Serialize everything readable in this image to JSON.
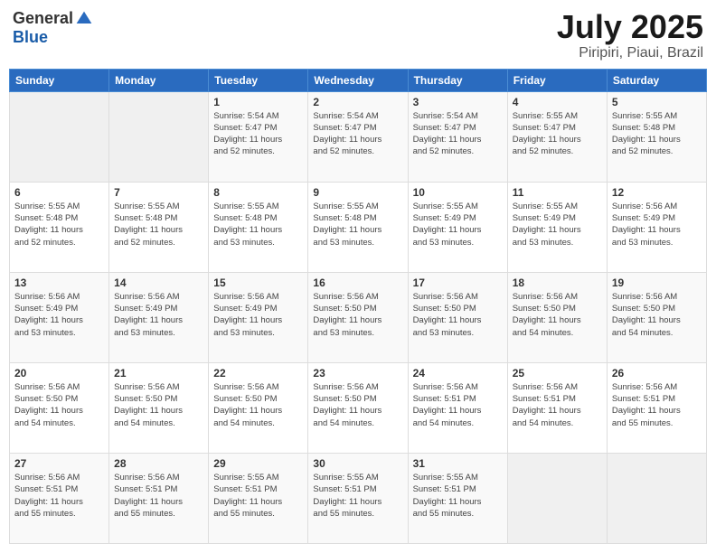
{
  "header": {
    "logo_general": "General",
    "logo_blue": "Blue",
    "month_title": "July 2025",
    "location": "Piripiri, Piaui, Brazil"
  },
  "calendar": {
    "headers": [
      "Sunday",
      "Monday",
      "Tuesday",
      "Wednesday",
      "Thursday",
      "Friday",
      "Saturday"
    ],
    "weeks": [
      [
        {
          "day": "",
          "info": ""
        },
        {
          "day": "",
          "info": ""
        },
        {
          "day": "1",
          "info": "Sunrise: 5:54 AM\nSunset: 5:47 PM\nDaylight: 11 hours\nand 52 minutes."
        },
        {
          "day": "2",
          "info": "Sunrise: 5:54 AM\nSunset: 5:47 PM\nDaylight: 11 hours\nand 52 minutes."
        },
        {
          "day": "3",
          "info": "Sunrise: 5:54 AM\nSunset: 5:47 PM\nDaylight: 11 hours\nand 52 minutes."
        },
        {
          "day": "4",
          "info": "Sunrise: 5:55 AM\nSunset: 5:47 PM\nDaylight: 11 hours\nand 52 minutes."
        },
        {
          "day": "5",
          "info": "Sunrise: 5:55 AM\nSunset: 5:48 PM\nDaylight: 11 hours\nand 52 minutes."
        }
      ],
      [
        {
          "day": "6",
          "info": "Sunrise: 5:55 AM\nSunset: 5:48 PM\nDaylight: 11 hours\nand 52 minutes."
        },
        {
          "day": "7",
          "info": "Sunrise: 5:55 AM\nSunset: 5:48 PM\nDaylight: 11 hours\nand 52 minutes."
        },
        {
          "day": "8",
          "info": "Sunrise: 5:55 AM\nSunset: 5:48 PM\nDaylight: 11 hours\nand 53 minutes."
        },
        {
          "day": "9",
          "info": "Sunrise: 5:55 AM\nSunset: 5:48 PM\nDaylight: 11 hours\nand 53 minutes."
        },
        {
          "day": "10",
          "info": "Sunrise: 5:55 AM\nSunset: 5:49 PM\nDaylight: 11 hours\nand 53 minutes."
        },
        {
          "day": "11",
          "info": "Sunrise: 5:55 AM\nSunset: 5:49 PM\nDaylight: 11 hours\nand 53 minutes."
        },
        {
          "day": "12",
          "info": "Sunrise: 5:56 AM\nSunset: 5:49 PM\nDaylight: 11 hours\nand 53 minutes."
        }
      ],
      [
        {
          "day": "13",
          "info": "Sunrise: 5:56 AM\nSunset: 5:49 PM\nDaylight: 11 hours\nand 53 minutes."
        },
        {
          "day": "14",
          "info": "Sunrise: 5:56 AM\nSunset: 5:49 PM\nDaylight: 11 hours\nand 53 minutes."
        },
        {
          "day": "15",
          "info": "Sunrise: 5:56 AM\nSunset: 5:49 PM\nDaylight: 11 hours\nand 53 minutes."
        },
        {
          "day": "16",
          "info": "Sunrise: 5:56 AM\nSunset: 5:50 PM\nDaylight: 11 hours\nand 53 minutes."
        },
        {
          "day": "17",
          "info": "Sunrise: 5:56 AM\nSunset: 5:50 PM\nDaylight: 11 hours\nand 53 minutes."
        },
        {
          "day": "18",
          "info": "Sunrise: 5:56 AM\nSunset: 5:50 PM\nDaylight: 11 hours\nand 54 minutes."
        },
        {
          "day": "19",
          "info": "Sunrise: 5:56 AM\nSunset: 5:50 PM\nDaylight: 11 hours\nand 54 minutes."
        }
      ],
      [
        {
          "day": "20",
          "info": "Sunrise: 5:56 AM\nSunset: 5:50 PM\nDaylight: 11 hours\nand 54 minutes."
        },
        {
          "day": "21",
          "info": "Sunrise: 5:56 AM\nSunset: 5:50 PM\nDaylight: 11 hours\nand 54 minutes."
        },
        {
          "day": "22",
          "info": "Sunrise: 5:56 AM\nSunset: 5:50 PM\nDaylight: 11 hours\nand 54 minutes."
        },
        {
          "day": "23",
          "info": "Sunrise: 5:56 AM\nSunset: 5:50 PM\nDaylight: 11 hours\nand 54 minutes."
        },
        {
          "day": "24",
          "info": "Sunrise: 5:56 AM\nSunset: 5:51 PM\nDaylight: 11 hours\nand 54 minutes."
        },
        {
          "day": "25",
          "info": "Sunrise: 5:56 AM\nSunset: 5:51 PM\nDaylight: 11 hours\nand 54 minutes."
        },
        {
          "day": "26",
          "info": "Sunrise: 5:56 AM\nSunset: 5:51 PM\nDaylight: 11 hours\nand 55 minutes."
        }
      ],
      [
        {
          "day": "27",
          "info": "Sunrise: 5:56 AM\nSunset: 5:51 PM\nDaylight: 11 hours\nand 55 minutes."
        },
        {
          "day": "28",
          "info": "Sunrise: 5:56 AM\nSunset: 5:51 PM\nDaylight: 11 hours\nand 55 minutes."
        },
        {
          "day": "29",
          "info": "Sunrise: 5:55 AM\nSunset: 5:51 PM\nDaylight: 11 hours\nand 55 minutes."
        },
        {
          "day": "30",
          "info": "Sunrise: 5:55 AM\nSunset: 5:51 PM\nDaylight: 11 hours\nand 55 minutes."
        },
        {
          "day": "31",
          "info": "Sunrise: 5:55 AM\nSunset: 5:51 PM\nDaylight: 11 hours\nand 55 minutes."
        },
        {
          "day": "",
          "info": ""
        },
        {
          "day": "",
          "info": ""
        }
      ]
    ]
  }
}
